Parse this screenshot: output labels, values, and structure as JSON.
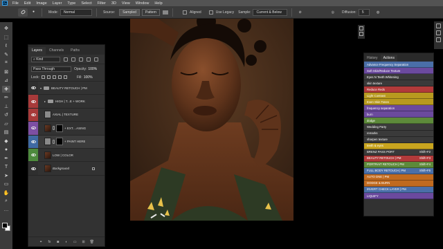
{
  "menu": [
    "File",
    "Edit",
    "Image",
    "Layer",
    "Type",
    "Select",
    "Filter",
    "3D",
    "View",
    "Window",
    "Help"
  ],
  "options": {
    "mode_label": "Mode:",
    "mode_value": "Normal",
    "source_label": "Source:",
    "source_sampled": "Sampled",
    "source_pattern": "Pattern",
    "aligned_label": "Aligned",
    "legacy_label": "Use Legacy",
    "sample_label": "Sample:",
    "sample_value": "Current & Below",
    "diffusion_label": "Diffusion:",
    "diffusion_value": "5"
  },
  "tools": [
    "move-icon",
    "marquee-icon",
    "lasso-icon",
    "quick-select-icon",
    "crop-icon",
    "frame-icon",
    "eyedropper-icon",
    "healing-brush-icon",
    "brush-icon",
    "clone-stamp-icon",
    "history-brush-icon",
    "eraser-icon",
    "gradient-icon",
    "blur-icon",
    "dodge-icon",
    "pen-icon",
    "type-icon",
    "path-select-icon",
    "rectangle-icon",
    "hand-icon",
    "zoom-icon",
    "more-tools-icon"
  ],
  "layers_panel": {
    "tabs": [
      "Layers",
      "Channels",
      "Paths"
    ],
    "kind_label": "Kind",
    "blend_mode": "Pass Through",
    "opacity_label": "Opacity:",
    "opacity_value": "100%",
    "lock_label": "Lock:",
    "fill_label": "Fill:",
    "fill_value": "100%",
    "layers": [
      {
        "name": "BEAUTY RETOUCH | PM",
        "type": "group",
        "eye_color": "#2f2f2f"
      },
      {
        "name": "HIGH | T...E + WORK",
        "type": "group",
        "eye_color": "#a83a3a"
      },
      {
        "name": "AXIAL | TEXTURE",
        "type": "pixel",
        "eye_color": "#a83a3a"
      },
      {
        "name": "+ EXT....ASING",
        "type": "masked",
        "eye_color": "#7d4fa3"
      },
      {
        "name": "+ PAINT HERE",
        "type": "masked",
        "eye_color": "#3f6aa3"
      },
      {
        "name": "LOW | COLOR",
        "type": "pixel",
        "eye_color": "#4d8a3d"
      },
      {
        "name": "Background",
        "type": "background",
        "eye_color": "#2f2f2f"
      }
    ],
    "footer": [
      "link-icon",
      "fx-icon",
      "mask-icon",
      "adjustment-icon",
      "group-icon",
      "new-layer-icon",
      "trash-icon"
    ]
  },
  "actions_panel": {
    "tabs": [
      "History",
      "Actions"
    ],
    "items": [
      {
        "label": "Advance Frequency Separation",
        "key": "",
        "color": "#4a6fa8"
      },
      {
        "label": "Soft Skin/Reduce Texture",
        "key": "",
        "color": "#6b4a9e"
      },
      {
        "label": "Eyes N Teeth Whitening",
        "key": "",
        "color": "#3a3a3a"
      },
      {
        "label": "skin texture",
        "key": "",
        "color": "#3a3a3a"
      },
      {
        "label": "Reduce Reds",
        "key": "",
        "color": "#b23a3a"
      },
      {
        "label": "Light Contrast",
        "key": "",
        "color": "#b89a1f"
      },
      {
        "label": "Even Skin Tones",
        "key": "",
        "color": "#b89a1f"
      },
      {
        "label": "frequency separation",
        "key": "",
        "color": "#6b4a9e"
      },
      {
        "label": "burn",
        "key": "",
        "color": "#6b4a9e"
      },
      {
        "label": "dodge",
        "key": "",
        "color": "#5d8a3a"
      },
      {
        "label": "Wedding Party",
        "key": "",
        "color": "#3a3a3a"
      },
      {
        "label": "remarks",
        "key": "",
        "color": "#3a3a3a"
      },
      {
        "label": "sharpen texture",
        "key": "",
        "color": "#3a3a3a"
      },
      {
        "label": "teeth & eyes",
        "key": "",
        "color": "#c9a51f"
      },
      {
        "label": "BRENZ PASS PORT",
        "key": "Shift+F2",
        "color": "#3a3a3a"
      },
      {
        "label": "BEAUTY RETOUCH | PM",
        "key": "Shift+F3",
        "color": "#b23a3a"
      },
      {
        "label": "PORTRAIT RETOUCH | PM",
        "key": "Shift+F4",
        "color": "#5d8a3a"
      },
      {
        "label": "FULL BODY RETOUCH | PM",
        "key": "Shift+F5",
        "color": "#4a6fa8"
      },
      {
        "label": "AUTO DNE | PM",
        "key": "",
        "color": "#c06a1f"
      },
      {
        "label": "DODGE & BURN",
        "key": "",
        "color": "#c06a1f"
      },
      {
        "label": "INVERT CHECK LAYER | PM",
        "key": "",
        "color": "#4a6fa8"
      },
      {
        "label": "LIQUIFY",
        "key": "",
        "color": "#6b4a9e"
      }
    ]
  }
}
